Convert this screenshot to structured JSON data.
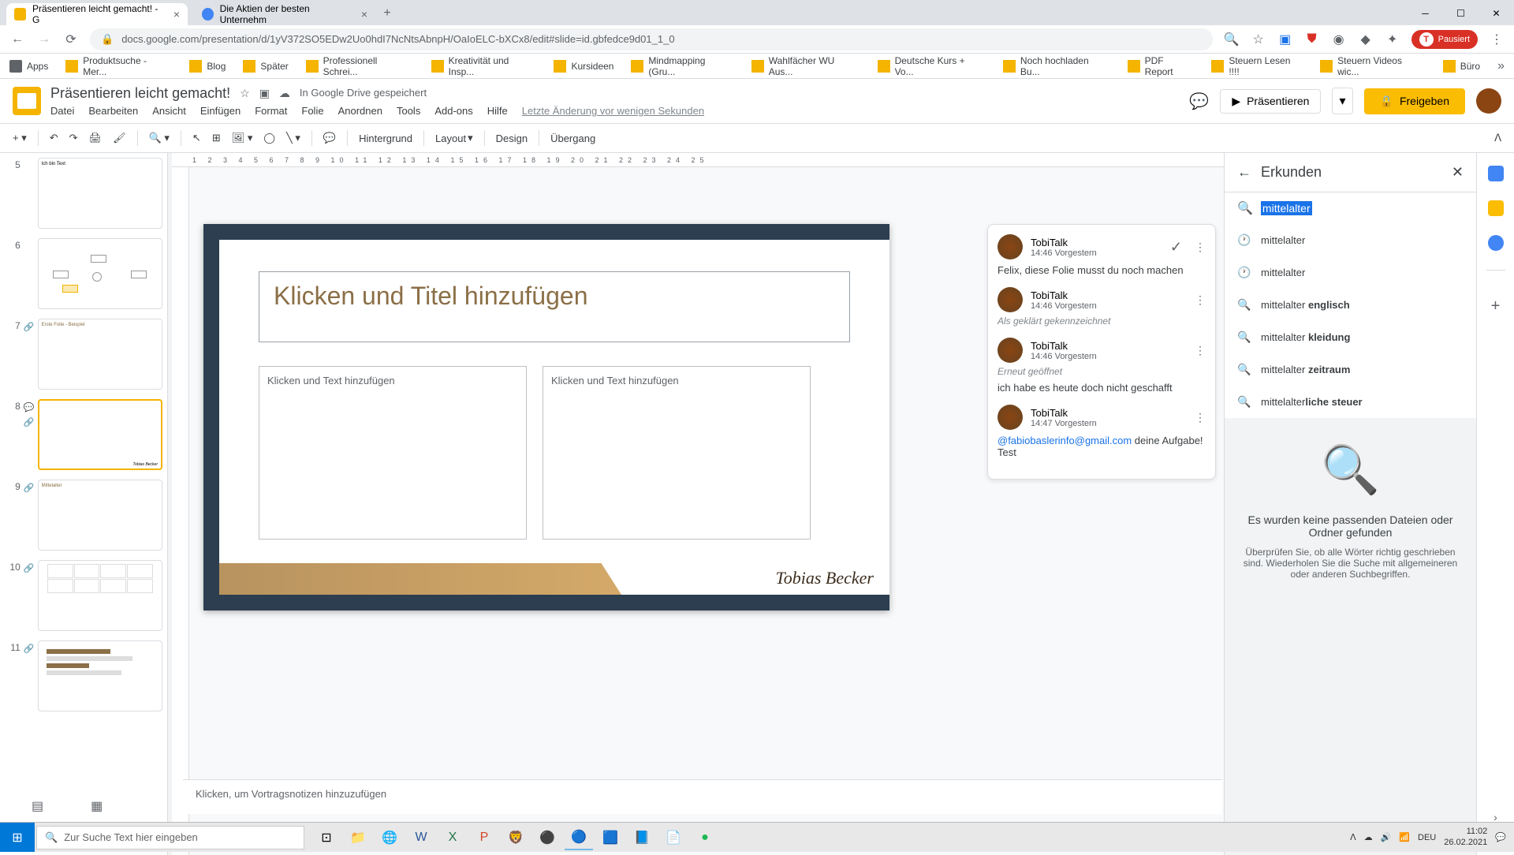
{
  "browser": {
    "tabs": [
      {
        "title": "Präsentieren leicht gemacht! - G",
        "active": true
      },
      {
        "title": "Die Aktien der besten Unternehm",
        "active": false
      }
    ],
    "url": "docs.google.com/presentation/d/1yV372SO5EDw2Uo0hdI7NcNtsAbnpH/OaIoELC-bXCx8/edit#slide=id.gbfedce9d01_1_0",
    "bookmarks": [
      "Apps",
      "Produktsuche - Mer...",
      "Blog",
      "Später",
      "Professionell Schrei...",
      "Kreativität und Insp...",
      "Kursideen",
      "Mindmapping  (Gru...",
      "Wahlfächer WU Aus...",
      "Deutsche Kurs + Vo...",
      "Noch hochladen Bu...",
      "PDF Report",
      "Steuern Lesen !!!!",
      "Steuern Videos wic...",
      "Büro"
    ],
    "profile_status": "Pausiert"
  },
  "doc": {
    "title": "Präsentieren leicht gemacht!",
    "save_status": "In Google Drive gespeichert",
    "menus": [
      "Datei",
      "Bearbeiten",
      "Ansicht",
      "Einfügen",
      "Format",
      "Folie",
      "Anordnen",
      "Tools",
      "Add-ons",
      "Hilfe"
    ],
    "last_edit": "Letzte Änderung vor wenigen Sekunden",
    "present_label": "Präsentieren",
    "share_label": "Freigeben"
  },
  "toolbar": {
    "background": "Hintergrund",
    "layout": "Layout",
    "design": "Design",
    "transition": "Übergang"
  },
  "thumbs": [
    {
      "num": "5",
      "text": "Ich bin Text"
    },
    {
      "num": "6",
      "text": ""
    },
    {
      "num": "7",
      "text": "Erste Folie - Beispiel"
    },
    {
      "num": "8",
      "text": "",
      "active": true
    },
    {
      "num": "9",
      "text": "Mittelalter"
    },
    {
      "num": "10",
      "text": ""
    },
    {
      "num": "11",
      "text": ""
    }
  ],
  "slide": {
    "title_placeholder": "Klicken und Titel hinzufügen",
    "text_placeholder": "Klicken und Text hinzufügen",
    "signature": "Tobias Becker"
  },
  "ruler_h": "1   2   3   4   5   6   7   8   9   10  11  12  13  14  15  16  17  18  19  20  21  22  23  24  25",
  "comments": [
    {
      "name": "TobiTalk",
      "time": "14:46 Vorgestern",
      "body": "Felix, diese Folie musst du noch machen",
      "resolvable": true
    },
    {
      "name": "TobiTalk",
      "time": "14:46 Vorgestern",
      "status": "Als geklärt gekennzeichnet"
    },
    {
      "name": "TobiTalk",
      "time": "14:46 Vorgestern",
      "status": "Erneut geöffnet",
      "body": "ich habe es heute doch nicht geschafft"
    },
    {
      "name": "TobiTalk",
      "time": "14:47 Vorgestern",
      "mention": "@fabiobaslerinfo@gmail.com",
      "body_after": " deine Aufgabe! Test"
    }
  ],
  "explore": {
    "title": "Erkunden",
    "search_value": "mittelalter",
    "suggestions": [
      {
        "icon": "history",
        "text": "mittelalter"
      },
      {
        "icon": "history",
        "text": "mittelalter"
      },
      {
        "icon": "search",
        "text": "mittelalter ",
        "bold": "englisch"
      },
      {
        "icon": "search",
        "text": "mittelalter ",
        "bold": "kleidung"
      },
      {
        "icon": "search",
        "text": "mittelalter ",
        "bold": "zeitraum"
      },
      {
        "icon": "search",
        "text": "mittelalter",
        "bold": "liche steuer"
      }
    ],
    "empty_title": "Es wurden keine passenden Dateien oder Ordner gefunden",
    "empty_desc": "Überprüfen Sie, ob alle Wörter richtig geschrieben sind. Wiederholen Sie die Suche mit allgemeineren oder anderen Suchbegriffen."
  },
  "speaker_notes": "Klicken, um Vortragsnotizen hinzuzufügen",
  "taskbar": {
    "search_placeholder": "Zur Suche Text hier eingeben",
    "lang": "DEU",
    "time": "11:02",
    "date": "26.02.2021"
  }
}
